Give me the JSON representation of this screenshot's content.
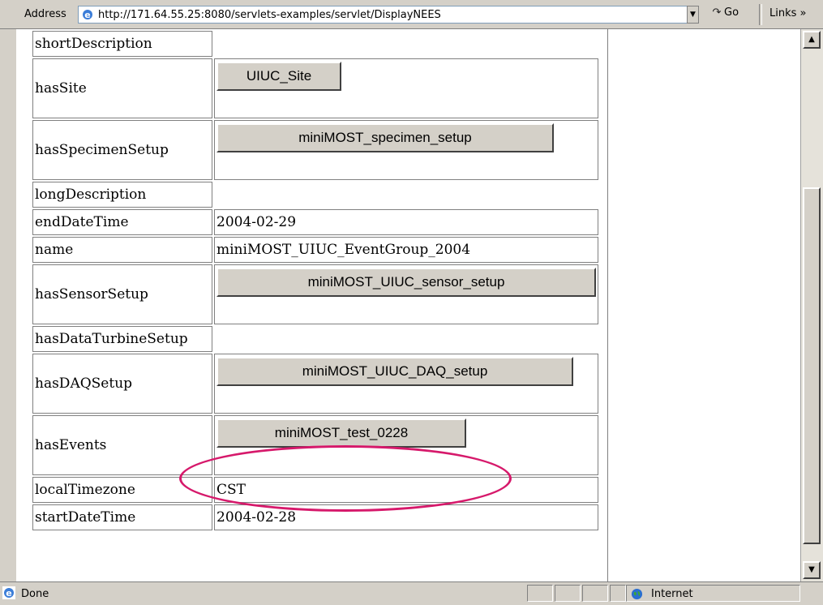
{
  "browser": {
    "address_label": "Address",
    "url": "http://171.64.55.25:8080/servlets-examples/servlet/DisplayNEES",
    "go_label": "Go",
    "links_label": "Links »"
  },
  "properties": [
    {
      "key": "shortDescription",
      "value": "",
      "type": "text"
    },
    {
      "key": "hasSite",
      "value": "UIUC_Site",
      "type": "button"
    },
    {
      "key": "hasSpecimenSetup",
      "value": "miniMOST_specimen_setup",
      "type": "button"
    },
    {
      "key": "longDescription",
      "value": "",
      "type": "text"
    },
    {
      "key": "endDateTime",
      "value": "2004-02-29",
      "type": "text"
    },
    {
      "key": "name",
      "value": "miniMOST_UIUC_EventGroup_2004",
      "type": "text"
    },
    {
      "key": "hasSensorSetup",
      "value": "miniMOST_UIUC_sensor_setup",
      "type": "button"
    },
    {
      "key": "hasDataTurbineSetup",
      "value": "",
      "type": "text"
    },
    {
      "key": "hasDAQSetup",
      "value": "miniMOST_UIUC_DAQ_setup",
      "type": "button"
    },
    {
      "key": "hasEvents",
      "value": "miniMOST_test_0228",
      "type": "button"
    },
    {
      "key": "localTimezone",
      "value": "CST",
      "type": "text"
    },
    {
      "key": "startDateTime",
      "value": "2004-02-28",
      "type": "text"
    }
  ],
  "status": {
    "text": "Done",
    "zone": "Internet"
  },
  "annotation": {
    "highlight_color": "#d6196b",
    "highlighted_item": "miniMOST_test_0228"
  },
  "icons": [
    "ie-page-icon",
    "go-arrow-icon",
    "scroll-up-icon",
    "scroll-down-icon",
    "dropdown-arrow-icon",
    "globe-icon"
  ]
}
